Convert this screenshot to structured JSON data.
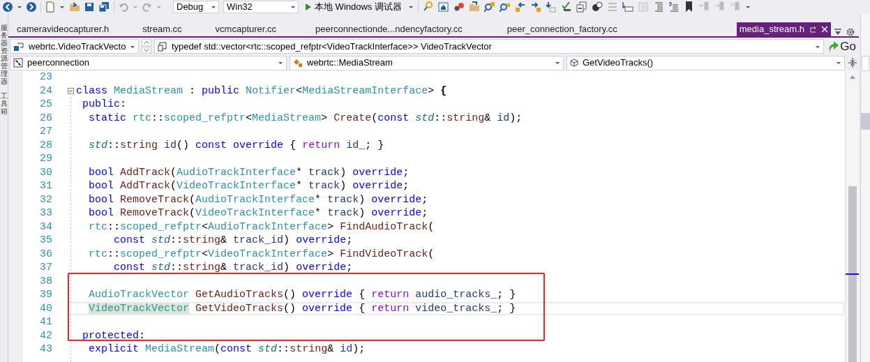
{
  "toolbar": {
    "configuration": "Debug",
    "platform": "Win32",
    "run_label": "本地 Windows 调试器"
  },
  "side_strip": {
    "items": [
      "服务器资源管理器",
      "工具箱"
    ]
  },
  "tabs": [
    {
      "label": "cameravideocapturer.h",
      "selected": false
    },
    {
      "label": "stream.cc",
      "selected": false
    },
    {
      "label": "vcmcapturer.cc",
      "selected": false
    },
    {
      "label": "peerconnectionde...ndencyfactory.cc",
      "selected": false
    },
    {
      "label": "peer_connection_factory.cc",
      "selected": false
    },
    {
      "label": "media_stream.h",
      "selected": true
    }
  ],
  "navigation": {
    "scope": "webrtc.VideoTrackVecto",
    "definition": "typedef std::vector<rtc::scoped_refptr<VideoTrackInterface>> VideoTrackVector",
    "go_label": "Go",
    "project": "peerconnection",
    "type": "webrtc::MediaStream",
    "member": "GetVideoTracks()"
  },
  "code_lines": [
    {
      "number": "23",
      "current": false,
      "collapsible": false
    },
    {
      "number": "24",
      "current": false,
      "collapsible": true,
      "tokens": [
        {
          "kind": "keyword",
          "text": "class "
        },
        {
          "kind": "type",
          "text": "MediaStream"
        },
        {
          "kind": "plain",
          "text": " : "
        },
        {
          "kind": "keyword",
          "text": "public "
        },
        {
          "kind": "type",
          "text": "Notifier"
        },
        {
          "kind": "plain",
          "text": "<"
        },
        {
          "kind": "type",
          "text": "MediaStreamInterface"
        },
        {
          "kind": "plain",
          "text": "> "
        },
        {
          "kind": "brace",
          "text": "{"
        }
      ]
    },
    {
      "number": "25",
      "current": false,
      "collapsible": false,
      "tokens": [
        {
          "kind": "keyword",
          "text": " public"
        },
        {
          "kind": "plain",
          "text": ":"
        }
      ]
    },
    {
      "number": "26",
      "current": false,
      "collapsible": false,
      "tokens": [
        {
          "kind": "keyword",
          "text": "  static "
        },
        {
          "kind": "type",
          "text": "rtc"
        },
        {
          "kind": "plain",
          "text": "::"
        },
        {
          "kind": "type",
          "text": "scoped_refptr"
        },
        {
          "kind": "plain",
          "text": "<"
        },
        {
          "kind": "type",
          "text": "MediaStream"
        },
        {
          "kind": "plain",
          "text": "> "
        },
        {
          "kind": "function",
          "text": "Create"
        },
        {
          "kind": "plain",
          "text": "("
        },
        {
          "kind": "keyword",
          "text": "const "
        },
        {
          "kind": "namespace",
          "text": "std"
        },
        {
          "kind": "plain",
          "text": "::"
        },
        {
          "kind": "function",
          "text": "string"
        },
        {
          "kind": "plain",
          "text": "& "
        },
        {
          "kind": "identifier",
          "text": "id"
        },
        {
          "kind": "plain",
          "text": ");"
        }
      ]
    },
    {
      "number": "27",
      "current": false,
      "collapsible": false
    },
    {
      "number": "28",
      "current": false,
      "collapsible": false,
      "tokens": [
        {
          "kind": "namespace",
          "text": "  std"
        },
        {
          "kind": "plain",
          "text": "::"
        },
        {
          "kind": "function",
          "text": "string "
        },
        {
          "kind": "identifier",
          "text": "id"
        },
        {
          "kind": "plain",
          "text": "() "
        },
        {
          "kind": "keyword",
          "text": "const override"
        },
        {
          "kind": "plain",
          "text": " { "
        },
        {
          "kind": "control",
          "text": "return "
        },
        {
          "kind": "identifier",
          "text": "id_"
        },
        {
          "kind": "plain",
          "text": "; }"
        }
      ]
    },
    {
      "number": "29",
      "current": false,
      "collapsible": false
    },
    {
      "number": "30",
      "current": false,
      "collapsible": false,
      "tokens": [
        {
          "kind": "keyword",
          "text": "  bool "
        },
        {
          "kind": "function",
          "text": "AddTrack"
        },
        {
          "kind": "plain",
          "text": "("
        },
        {
          "kind": "type",
          "text": "AudioTrackInterface"
        },
        {
          "kind": "plain",
          "text": "* "
        },
        {
          "kind": "identifier",
          "text": "track"
        },
        {
          "kind": "plain",
          "text": ") "
        },
        {
          "kind": "keyword",
          "text": "override"
        },
        {
          "kind": "plain",
          "text": ";"
        }
      ]
    },
    {
      "number": "31",
      "current": false,
      "collapsible": false,
      "tokens": [
        {
          "kind": "keyword",
          "text": "  bool "
        },
        {
          "kind": "function",
          "text": "AddTrack"
        },
        {
          "kind": "plain",
          "text": "("
        },
        {
          "kind": "type",
          "text": "VideoTrackInterface"
        },
        {
          "kind": "plain",
          "text": "* "
        },
        {
          "kind": "identifier",
          "text": "track"
        },
        {
          "kind": "plain",
          "text": ") "
        },
        {
          "kind": "keyword",
          "text": "override"
        },
        {
          "kind": "plain",
          "text": ";"
        }
      ]
    },
    {
      "number": "32",
      "current": false,
      "collapsible": false,
      "tokens": [
        {
          "kind": "keyword",
          "text": "  bool "
        },
        {
          "kind": "function",
          "text": "RemoveTrack"
        },
        {
          "kind": "plain",
          "text": "("
        },
        {
          "kind": "type",
          "text": "AudioTrackInterface"
        },
        {
          "kind": "plain",
          "text": "* "
        },
        {
          "kind": "identifier",
          "text": "track"
        },
        {
          "kind": "plain",
          "text": ") "
        },
        {
          "kind": "keyword",
          "text": "override"
        },
        {
          "kind": "plain",
          "text": ";"
        }
      ]
    },
    {
      "number": "33",
      "current": false,
      "collapsible": false,
      "tokens": [
        {
          "kind": "keyword",
          "text": "  bool "
        },
        {
          "kind": "function",
          "text": "RemoveTrack"
        },
        {
          "kind": "plain",
          "text": "("
        },
        {
          "kind": "type",
          "text": "VideoTrackInterface"
        },
        {
          "kind": "plain",
          "text": "* "
        },
        {
          "kind": "identifier",
          "text": "track"
        },
        {
          "kind": "plain",
          "text": ") "
        },
        {
          "kind": "keyword",
          "text": "override"
        },
        {
          "kind": "plain",
          "text": ";"
        }
      ]
    },
    {
      "number": "34",
      "current": false,
      "collapsible": false,
      "tokens": [
        {
          "kind": "type",
          "text": "  rtc"
        },
        {
          "kind": "plain",
          "text": "::"
        },
        {
          "kind": "type",
          "text": "scoped_refptr"
        },
        {
          "kind": "plain",
          "text": "<"
        },
        {
          "kind": "type",
          "text": "AudioTrackInterface"
        },
        {
          "kind": "plain",
          "text": "> "
        },
        {
          "kind": "function",
          "text": "FindAudioTrack"
        },
        {
          "kind": "plain",
          "text": "("
        }
      ]
    },
    {
      "number": "35",
      "current": false,
      "collapsible": false,
      "tokens": [
        {
          "kind": "keyword",
          "text": "      const "
        },
        {
          "kind": "namespace",
          "text": "std"
        },
        {
          "kind": "plain",
          "text": "::"
        },
        {
          "kind": "function",
          "text": "string"
        },
        {
          "kind": "plain",
          "text": "& "
        },
        {
          "kind": "identifier",
          "text": "track_id"
        },
        {
          "kind": "plain",
          "text": ") "
        },
        {
          "kind": "keyword",
          "text": "override"
        },
        {
          "kind": "plain",
          "text": ";"
        }
      ]
    },
    {
      "number": "36",
      "current": false,
      "collapsible": false,
      "tokens": [
        {
          "kind": "type",
          "text": "  rtc"
        },
        {
          "kind": "plain",
          "text": "::"
        },
        {
          "kind": "type",
          "text": "scoped_refptr"
        },
        {
          "kind": "plain",
          "text": "<"
        },
        {
          "kind": "type",
          "text": "VideoTrackInterface"
        },
        {
          "kind": "plain",
          "text": "> "
        },
        {
          "kind": "function",
          "text": "FindVideoTrack"
        },
        {
          "kind": "plain",
          "text": "("
        }
      ]
    },
    {
      "number": "37",
      "current": false,
      "collapsible": false,
      "tokens": [
        {
          "kind": "keyword",
          "text": "      const "
        },
        {
          "kind": "namespace",
          "text": "std"
        },
        {
          "kind": "plain",
          "text": "::"
        },
        {
          "kind": "function",
          "text": "string"
        },
        {
          "kind": "plain",
          "text": "& "
        },
        {
          "kind": "identifier",
          "text": "track_id"
        },
        {
          "kind": "plain",
          "text": ") "
        },
        {
          "kind": "keyword",
          "text": "override"
        },
        {
          "kind": "plain",
          "text": ";"
        }
      ]
    },
    {
      "number": "38",
      "current": false,
      "collapsible": false
    },
    {
      "number": "39",
      "current": false,
      "collapsible": false,
      "tokens": [
        {
          "kind": "type",
          "text": "  AudioTrackVector "
        },
        {
          "kind": "function",
          "text": "GetAudioTracks"
        },
        {
          "kind": "plain",
          "text": "() "
        },
        {
          "kind": "keyword",
          "text": "override"
        },
        {
          "kind": "plain",
          "text": " { "
        },
        {
          "kind": "control",
          "text": "return "
        },
        {
          "kind": "identifier",
          "text": "audio_tracks_"
        },
        {
          "kind": "plain",
          "text": "; }"
        }
      ]
    },
    {
      "number": "40",
      "current": true,
      "collapsible": false,
      "tokens": [
        {
          "kind": "highlighted-type",
          "text": "  VideoTrackVector"
        },
        {
          "kind": "function",
          "text": " GetVideoTracks"
        },
        {
          "kind": "plain",
          "text": "() "
        },
        {
          "kind": "keyword",
          "text": "override"
        },
        {
          "kind": "plain",
          "text": " { "
        },
        {
          "kind": "control",
          "text": "return "
        },
        {
          "kind": "identifier",
          "text": "video_tracks_"
        },
        {
          "kind": "plain",
          "text": "; }"
        }
      ]
    },
    {
      "number": "41",
      "current": false,
      "collapsible": false
    },
    {
      "number": "42",
      "current": false,
      "collapsible": false,
      "tokens": [
        {
          "kind": "keyword",
          "text": " protected"
        },
        {
          "kind": "plain",
          "text": ":"
        }
      ]
    },
    {
      "number": "43",
      "current": false,
      "collapsible": false,
      "tokens": [
        {
          "kind": "keyword",
          "text": "  explicit "
        },
        {
          "kind": "type",
          "text": "MediaStream"
        },
        {
          "kind": "plain",
          "text": "("
        },
        {
          "kind": "keyword",
          "text": "const "
        },
        {
          "kind": "namespace",
          "text": "std"
        },
        {
          "kind": "plain",
          "text": "::"
        },
        {
          "kind": "function",
          "text": "string"
        },
        {
          "kind": "plain",
          "text": "& "
        },
        {
          "kind": "identifier",
          "text": "id"
        },
        {
          "kind": "plain",
          "text": ");"
        }
      ]
    }
  ]
}
